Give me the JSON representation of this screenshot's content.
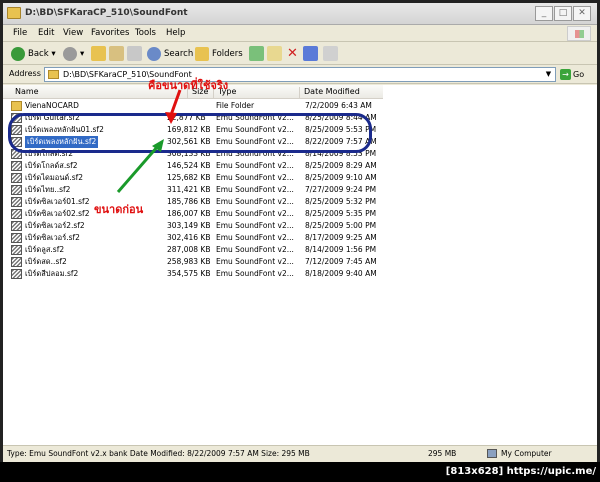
{
  "window": {
    "title": "D:\\BD\\SFKaraCP_510\\SoundFont"
  },
  "menu": [
    "File",
    "Edit",
    "View",
    "Favorites",
    "Tools",
    "Help"
  ],
  "toolbar": {
    "back": "Back",
    "search": "Search",
    "folders": "Folders"
  },
  "address": {
    "label": "Address",
    "value": "D:\\BD\\SFKaraCP_510\\SoundFont",
    "go": "Go"
  },
  "columns": {
    "name": "Name",
    "size": "Size",
    "type": "Type",
    "date": "Date Modified"
  },
  "rows": [
    {
      "name": "VienaNOCARD",
      "size": "",
      "type": "File Folder",
      "date": "7/2/2009 6:43 AM",
      "kind": "folder"
    },
    {
      "name": "เบิร์ด Guitar.sf2",
      "size": "22,877 KB",
      "type": "Emu SoundFont v2...",
      "date": "8/25/2009 8:44 AM",
      "kind": "file"
    },
    {
      "name": "เบิร์ดเพลงหลักฝัน01.sf2",
      "size": "169,812 KB",
      "type": "Emu SoundFont v2...",
      "date": "8/25/2009 5:53 PM",
      "kind": "file"
    },
    {
      "name": "เบิร์ดเพลงหลักฝัน.sf2",
      "size": "302,561 KB",
      "type": "Emu SoundFont v2...",
      "date": "8/22/2009 7:57 AM",
      "kind": "file",
      "selected": true
    },
    {
      "name": "เบิร์ดโกลด์.sf2",
      "size": "308,133 KB",
      "type": "Emu SoundFont v2...",
      "date": "8/14/2009 8:53 PM",
      "kind": "file"
    },
    {
      "name": "เบิร์ดโกลด์ส.sf2",
      "size": "146,524 KB",
      "type": "Emu SoundFont v2...",
      "date": "8/25/2009 8:29 AM",
      "kind": "file"
    },
    {
      "name": "เบิร์ดไดมอนด์.sf2",
      "size": "125,682 KB",
      "type": "Emu SoundFont v2...",
      "date": "8/25/2009 9:10 AM",
      "kind": "file"
    },
    {
      "name": "เบิร์ดไทย..sf2",
      "size": "311,421 KB",
      "type": "Emu SoundFont v2...",
      "date": "7/27/2009 9:24 PM",
      "kind": "file"
    },
    {
      "name": "เบิร์ดซิลเวอร์01.sf2",
      "size": "185,786 KB",
      "type": "Emu SoundFont v2...",
      "date": "8/25/2009 5:32 PM",
      "kind": "file"
    },
    {
      "name": "เบิร์ดซิลเวอร์02.sf2",
      "size": "186,007 KB",
      "type": "Emu SoundFont v2...",
      "date": "8/25/2009 5:35 PM",
      "kind": "file"
    },
    {
      "name": "เบิร์ดซิลเวอร์2.sf2",
      "size": "303,149 KB",
      "type": "Emu SoundFont v2...",
      "date": "8/25/2009 5:00 PM",
      "kind": "file"
    },
    {
      "name": "เบิร์ดซิลเวอร์.sf2",
      "size": "302,416 KB",
      "type": "Emu SoundFont v2...",
      "date": "8/17/2009 9:25 AM",
      "kind": "file"
    },
    {
      "name": "เบิร์ดลูส.sf2",
      "size": "287,008 KB",
      "type": "Emu SoundFont v2...",
      "date": "8/14/2009 1:56 PM",
      "kind": "file"
    },
    {
      "name": "เบิร์ดสด..sf2",
      "size": "258,983 KB",
      "type": "Emu SoundFont v2...",
      "date": "7/12/2009 7:45 AM",
      "kind": "file"
    },
    {
      "name": "เบิร์ดสีปลอม.sf2",
      "size": "354,575 KB",
      "type": "Emu SoundFont v2...",
      "date": "8/18/2009 9:40 AM",
      "kind": "file"
    }
  ],
  "annotations": {
    "top": "คือขนาดที่ใช้จริง",
    "left": "ขนาดก่อน"
  },
  "status": {
    "info": "Type: Emu SoundFont v2.x bank Date Modified: 8/22/2009 7:57 AM Size: 295 MB",
    "size": "295 MB",
    "location": "My Computer"
  },
  "footer": "[813x628] https://upic.me/",
  "colors": {
    "selection": "#316ac5",
    "annotation_red": "#e01010",
    "annotation_blue": "#1a2a8c",
    "annotation_green": "#1a9a2a"
  }
}
